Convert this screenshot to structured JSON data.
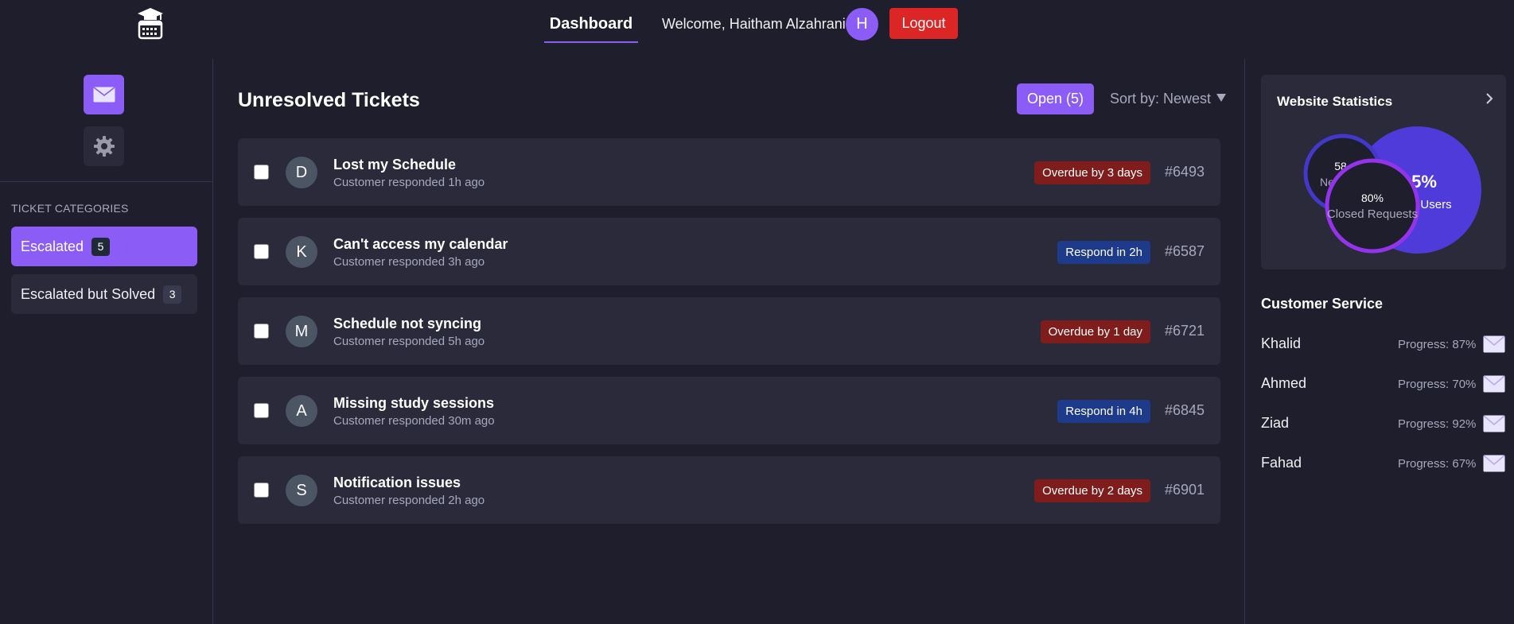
{
  "header": {
    "nav_dashboard": "Dashboard",
    "welcome": "Welcome, Haitham Alzahrani",
    "avatar_initial": "H",
    "logout": "Logout"
  },
  "sidebar": {
    "categories_heading": "TICKET CATEGORIES",
    "categories": [
      {
        "label": "Escalated",
        "count": "5"
      },
      {
        "label": "Escalated but Solved",
        "count": "3"
      }
    ]
  },
  "main": {
    "title": "Unresolved Tickets",
    "open_filter": "Open (5)",
    "sort_by": "Sort by: Newest",
    "tickets": [
      {
        "initial": "D",
        "title": "Lost my Schedule",
        "sub": "Customer responded 1h ago",
        "badge": "Overdue by 3 days",
        "badge_type": "overdue",
        "id": "#6493"
      },
      {
        "initial": "K",
        "title": "Can't access my calendar",
        "sub": "Customer responded 3h ago",
        "badge": "Respond in 2h",
        "badge_type": "respond",
        "id": "#6587"
      },
      {
        "initial": "M",
        "title": "Schedule not syncing",
        "sub": "Customer responded 5h ago",
        "badge": "Overdue by 1 day",
        "badge_type": "overdue",
        "id": "#6721"
      },
      {
        "initial": "A",
        "title": "Missing study sessions",
        "sub": "Customer responded 30m ago",
        "badge": "Respond in 4h",
        "badge_type": "respond",
        "id": "#6845"
      },
      {
        "initial": "S",
        "title": "Notification issues",
        "sub": "Customer responded 2h ago",
        "badge": "Overdue by 2 days",
        "badge_type": "overdue",
        "id": "#6901"
      }
    ]
  },
  "stats": {
    "title": "Website Statistics",
    "bubbles": [
      {
        "value": "5%",
        "label": "Users",
        "color": "#4f3bd9"
      },
      {
        "value": "58",
        "label": "New",
        "color": "#4338ca"
      },
      {
        "value": "80%",
        "label": "Closed Requests",
        "color": "#9333ea"
      }
    ]
  },
  "customer_service": {
    "title": "Customer Service",
    "agents": [
      {
        "name": "Khalid",
        "progress": "Progress: 87%"
      },
      {
        "name": "Ahmed",
        "progress": "Progress: 70%"
      },
      {
        "name": "Ziad",
        "progress": "Progress: 92%"
      },
      {
        "name": "Fahad",
        "progress": "Progress: 67%"
      }
    ]
  },
  "colors": {
    "accent": "#8b5cf6",
    "danger": "#dc2626",
    "overdue_badge": "#7f1d1d",
    "respond_badge": "#1e3a8a",
    "background": "#1e1e2d",
    "card": "#2a2a3b"
  },
  "icons": {
    "logo": "graduation-calendar-icon",
    "mail": "mail-icon",
    "settings": "gear-icon",
    "sort": "caret-down-icon",
    "chevron": "chevron-right-icon"
  }
}
